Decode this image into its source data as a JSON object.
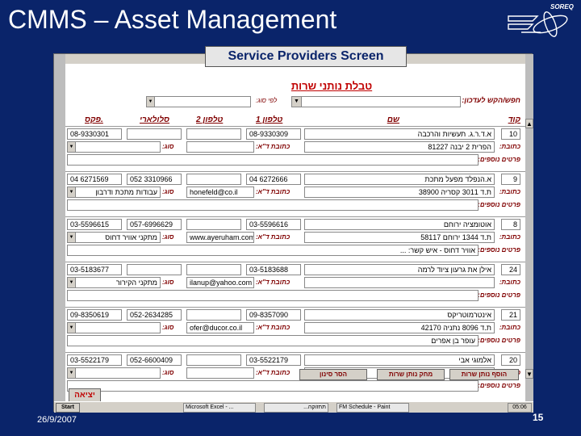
{
  "slide": {
    "title": "CMMS – Asset Management",
    "callout": "Service Providers Screen",
    "logo_text": "SOREQ",
    "date": "26/9/2007",
    "page_number": "15"
  },
  "form": {
    "title": "טבלת נותני שרות",
    "search_label": "חפש/הקש לעדכון:",
    "search_by_label": "לפי סוג:",
    "headers": {
      "code": "קוד",
      "name": "שם",
      "phone1": "טלפון 1",
      "phone2": "טלפון 2",
      "cellular": "סלולארי",
      "fax": "פקס."
    },
    "labels": {
      "address": "כתובת:",
      "email": "כתובת ד\"א:",
      "type": "סוג:",
      "details": "פרטים נוספים:"
    },
    "records": [
      {
        "code": "10",
        "name": "א.ד.ר.ג. תעשיות והרכבה",
        "phone1": "08-9330309",
        "phone2": "",
        "cellular": "",
        "fax": "08-9330301",
        "address": "הפרית 2 יבנה 81227",
        "email": "",
        "type": "",
        "details": ""
      },
      {
        "code": "9",
        "name": "א.הנפלד מפעל מתכת",
        "phone1": "04 6272666",
        "phone2": "",
        "cellular": "052 3310966",
        "fax": "04 6271569",
        "address": "ת.ד 3011 קסריה 38900",
        "email": "honefeld@co.il",
        "type": "עבודות מתכת ודרבון",
        "details": ""
      },
      {
        "code": "8",
        "name": "אוטומציה ירוחם",
        "phone1": "03-5596616",
        "phone2": "",
        "cellular": "057-6996629",
        "fax": "03-5596615",
        "address": "ת.ד 1344 ירוחם 58117",
        "email": "www.ayeruham.com",
        "type": "מתקני אוויר דחוס",
        "details": "אוויר דחוס - איש קשר: ..."
      },
      {
        "code": "24",
        "name": "אילן את גרעון ציוד לרמה",
        "phone1": "03-5183688",
        "phone2": "",
        "cellular": "",
        "fax": "03-5183677",
        "address": "",
        "email": "ilanup@yahoo.com",
        "type": "מתקני הקירור",
        "details": ""
      },
      {
        "code": "21",
        "name": "אינטרמוטריקס",
        "phone1": "09-8357090",
        "phone2": "",
        "cellular": "052-2634285",
        "fax": "09-8350619",
        "address": "ת.ד 8096 נתניה 42170",
        "email": "ofer@ducor.co.il",
        "type": "",
        "details": "עופר בן אפרים"
      },
      {
        "code": "20",
        "name": "אלמוגי אבי",
        "phone1": "03-5522179",
        "phone2": "",
        "cellular": "052-6600409",
        "fax": "03-5522179",
        "address": "",
        "email": "",
        "type": "",
        "details": ""
      }
    ],
    "buttons": {
      "add": "הוסף נותן שרות",
      "delete": "מחק נותן שרות",
      "filter": "הסר סינון",
      "exit": "יציאה"
    }
  },
  "taskbar": {
    "start": "Start",
    "tasks": [
      "Microsoft Excel - ...",
      "תחזוקה...",
      "FM Schedule - Paint"
    ],
    "clock": "05:06"
  },
  "colors": {
    "background": "#0a246a",
    "form_red": "#c00000",
    "label_maroon": "#800000"
  }
}
